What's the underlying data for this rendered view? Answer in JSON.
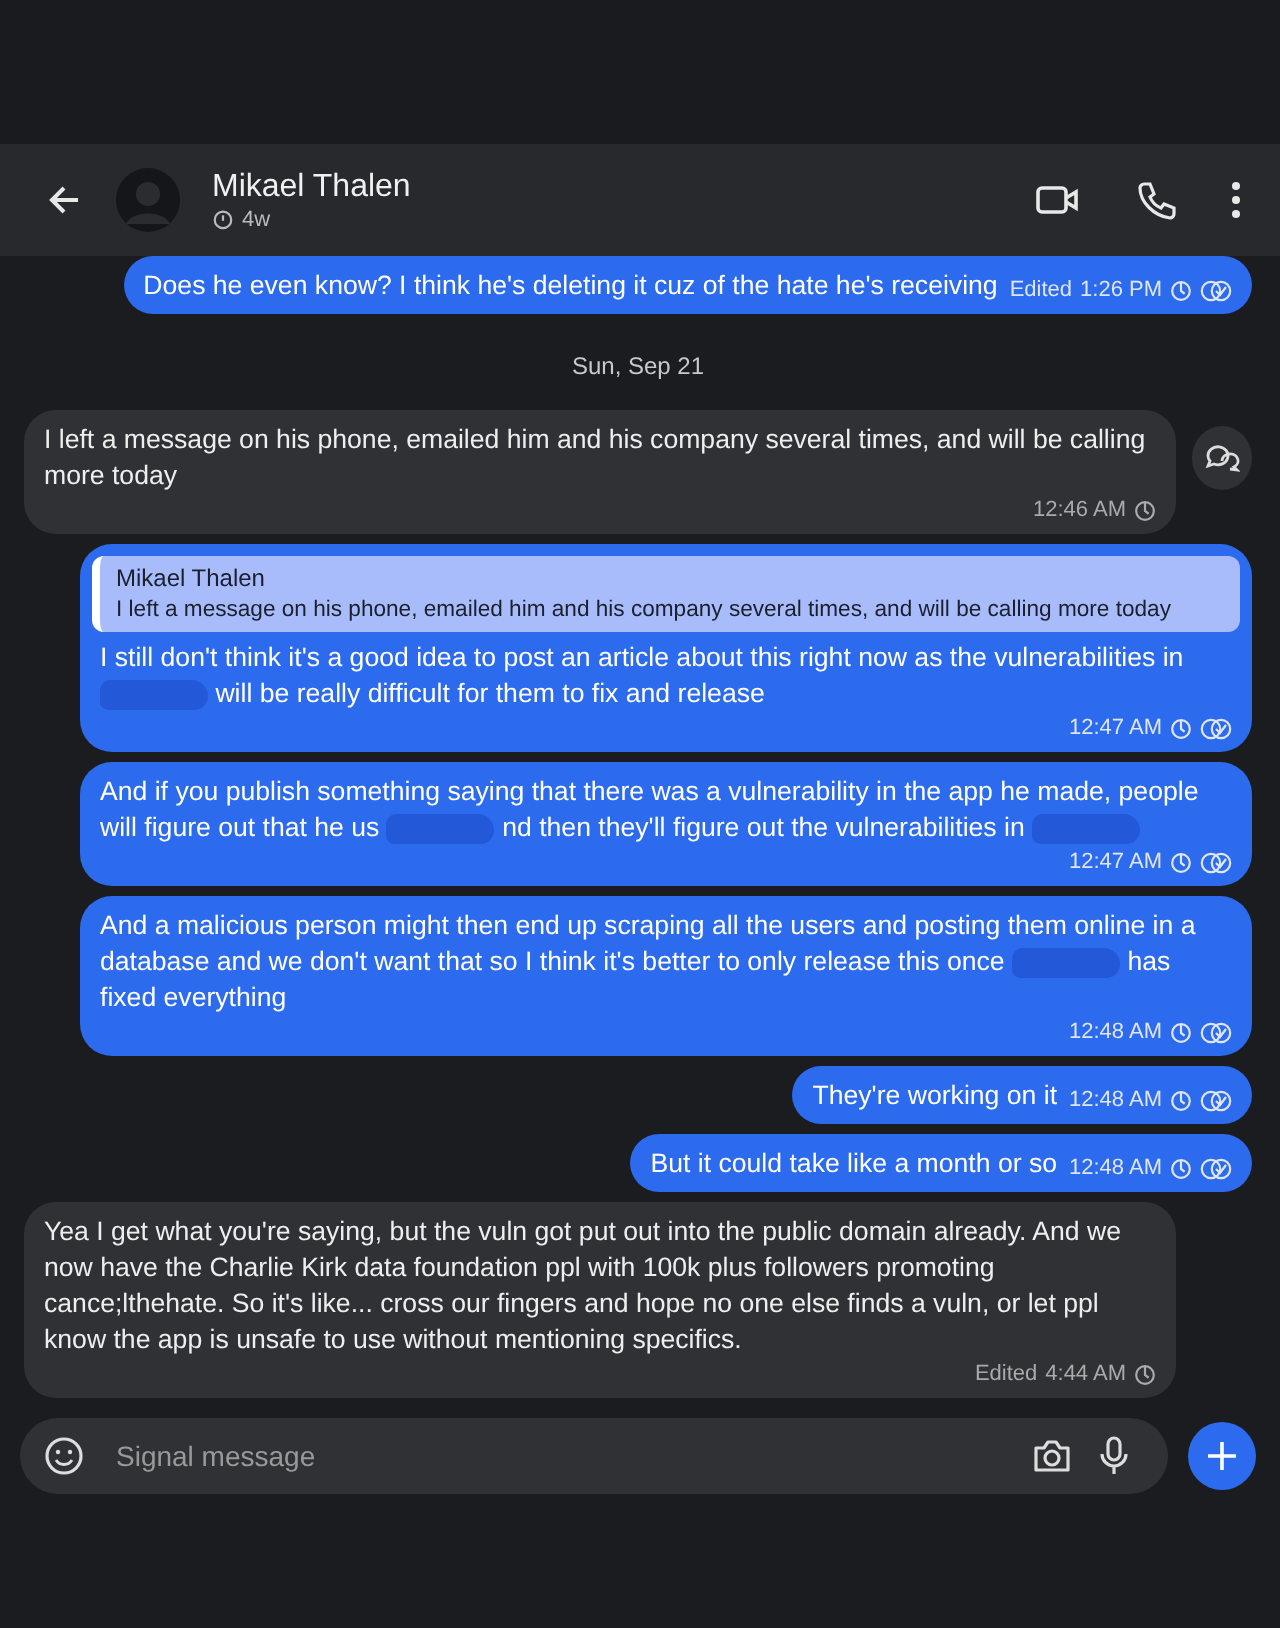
{
  "header": {
    "name": "Mikael Thalen",
    "timer": "4w"
  },
  "messages": [
    {
      "kind": "outgoing",
      "segments": [
        {
          "kind": "text",
          "text": "Does he even know? I think he's deleting it cuz of the hate he's receiving"
        }
      ],
      "edited_label": "Edited",
      "time": "1:26 PM"
    },
    {
      "kind": "date",
      "text": "Sun, Sep 21"
    },
    {
      "kind": "incoming",
      "segments": [
        {
          "kind": "text",
          "text": "I left a message on his phone, emailed him and his company several times, and will be calling more today"
        }
      ],
      "time": "12:46 AM",
      "side_button": true
    },
    {
      "kind": "outgoing",
      "quote": {
        "author": "Mikael Thalen",
        "text": "I left a message on his phone, emailed him and his company several times, and will be calling more today"
      },
      "segments": [
        {
          "kind": "text",
          "text": "I still don't think it's a good idea to post an article about this right now as the vulnerabilities in"
        },
        {
          "kind": "redaction"
        },
        {
          "kind": "text",
          "text": "will be really difficult for them to fix and release"
        }
      ],
      "time": "12:47 AM"
    },
    {
      "kind": "outgoing",
      "segments": [
        {
          "kind": "text",
          "text": "And if you publish something saying that there was a vulnerability in the app he made, people will figure out that he us"
        },
        {
          "kind": "redaction"
        },
        {
          "kind": "text",
          "text": "nd then they'll figure out the vulnerabilities in"
        },
        {
          "kind": "redaction"
        }
      ],
      "time": "12:47 AM"
    },
    {
      "kind": "outgoing",
      "segments": [
        {
          "kind": "text",
          "text": "And a malicious person might then end up scraping all the users and posting them online in a database and we don't want that so I think it's better to only release this once"
        },
        {
          "kind": "redaction"
        },
        {
          "kind": "text",
          "text": "has fixed everything"
        }
      ],
      "time": "12:48 AM"
    },
    {
      "kind": "outgoing",
      "segments": [
        {
          "kind": "text",
          "text": "They're working on it"
        }
      ],
      "time": "12:48 AM"
    },
    {
      "kind": "outgoing",
      "segments": [
        {
          "kind": "text",
          "text": "But it could take like a month or so"
        }
      ],
      "time": "12:48 AM"
    },
    {
      "kind": "incoming",
      "segments": [
        {
          "kind": "text",
          "text": "Yea I get what you're saying, but the vuln got put out into the public domain already.  And we now have the Charlie Kirk data foundation ppl with 100k plus followers promoting cance;lthehate. So it's like... cross our fingers and hope no one else finds a vuln, or let ppl know the app is unsafe to use without mentioning specifics."
        }
      ],
      "edited_label": "Edited",
      "time": "4:44 AM"
    }
  ],
  "composer": {
    "placeholder": "Signal message"
  }
}
